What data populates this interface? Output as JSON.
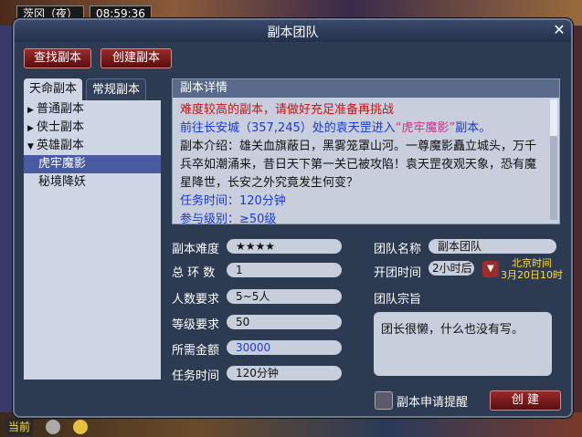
{
  "background": {
    "top_status": [
      "茨冈（夜）",
      "08:59:36"
    ],
    "bottom_status": {
      "current_channel": "当前"
    }
  },
  "window": {
    "title": "副本团队",
    "close_label": "✕"
  },
  "toolbar": {
    "find_label": "查找副本",
    "create_label": "创建副本"
  },
  "tabs": [
    {
      "label": "天命副本",
      "active": true
    },
    {
      "label": "常规副本",
      "active": false
    }
  ],
  "tree": [
    {
      "label": "普通副本",
      "icon": "triangle-right-icon"
    },
    {
      "label": "侠士副本",
      "icon": "triangle-right-icon"
    },
    {
      "label": "英雄副本",
      "icon": "triangle-down-icon"
    },
    {
      "label": "虎牢魔影",
      "selected": true
    },
    {
      "label": "秘境降妖"
    }
  ],
  "detail": {
    "header": "副本详情",
    "warning": "难度较高的副本，请做好充足准备再挑战",
    "line_goto_a": "前往长安城（357,245）处的袁天罡进入",
    "line_goto_b": "“虎牢魔影”",
    "line_goto_c": "副本。",
    "intro": "副本介绍：雄关血旗蔽日，黑雾笼罩山河。一尊魔影矗立城头，万千兵卒如潮涌来，昔日天下第一关已被攻陷！袁天罡夜观天象，恐有魔星降世，长安之外究竟发生何变？",
    "task_time": "任务时间：120分钟",
    "level": "参与级别：≥50级"
  },
  "form": {
    "difficulty_label": "副本难度",
    "difficulty_value": "★★★★",
    "rounds_label": "总 环 数",
    "rounds_value": "1",
    "people_label": "人数要求",
    "people_value": "5~5人",
    "level_label": "等级要求",
    "level_value": "50",
    "money_label": "所需金额",
    "money_value": "30000",
    "time_label": "任务时间",
    "time_value": "120分钟",
    "team_name_label": "团队名称",
    "team_name_value": "副本团队",
    "open_time_label": "开团时间",
    "open_time_value": "2小时后",
    "beijing_time_label": "北京时间",
    "beijing_time_value": "3月20日10时",
    "purpose_label": "团队宗旨",
    "purpose_value": "团长很懒，什么也没有写。",
    "remind_label": "副本申请提醒",
    "create_button": "创 建"
  }
}
